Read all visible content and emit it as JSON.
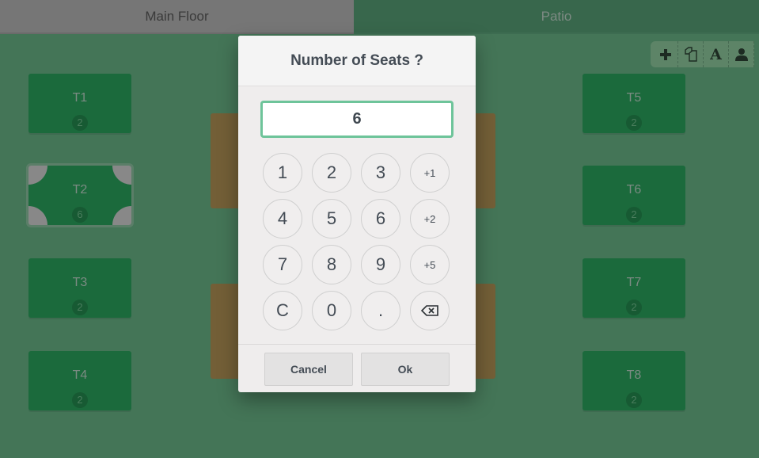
{
  "tabs": [
    {
      "label": "Main Floor",
      "active": true
    },
    {
      "label": "Patio",
      "active": false
    }
  ],
  "toolbar": {
    "items": [
      {
        "icon": "plus-icon",
        "label": "Add"
      },
      {
        "icon": "duplicate-icon",
        "label": "Duplicate"
      },
      {
        "icon": "text-icon",
        "label": "Rename"
      },
      {
        "icon": "user-icon",
        "label": "Seats"
      }
    ]
  },
  "tables": [
    {
      "name": "T1",
      "seats": "2",
      "selected": false
    },
    {
      "name": "T2",
      "seats": "6",
      "selected": true
    },
    {
      "name": "T3",
      "seats": "2",
      "selected": false
    },
    {
      "name": "T4",
      "seats": "2",
      "selected": false
    },
    {
      "name": "T5",
      "seats": "2",
      "selected": false
    },
    {
      "name": "T6",
      "seats": "2",
      "selected": false
    },
    {
      "name": "T7",
      "seats": "2",
      "selected": false
    },
    {
      "name": "T8",
      "seats": "2",
      "selected": false
    }
  ],
  "colors": {
    "floor": "#447557",
    "table": "#1b6a3c",
    "bench": "#735f37",
    "input_border": "#6ec49a"
  },
  "dialog": {
    "title": "Number of Seats ?",
    "value": "6",
    "keys": [
      [
        "1",
        "2",
        "3",
        "+1"
      ],
      [
        "4",
        "5",
        "6",
        "+2"
      ],
      [
        "7",
        "8",
        "9",
        "+5"
      ],
      [
        "C",
        "0",
        ".",
        "backspace"
      ]
    ],
    "cancel_label": "Cancel",
    "ok_label": "Ok"
  }
}
